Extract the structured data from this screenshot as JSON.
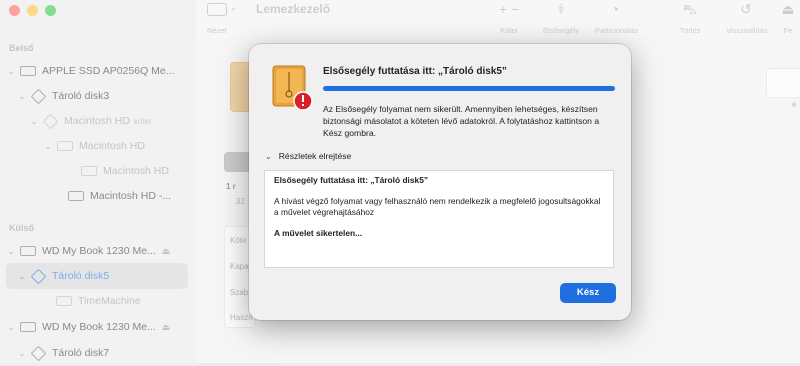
{
  "sidebar": {
    "sections": {
      "internal": "Belső",
      "external": "Külső"
    },
    "items": [
      {
        "label": "APPLE SSD AP0256Q Me..."
      },
      {
        "label": "Tároló disk3"
      },
      {
        "label": "Macintosh HD",
        "sub": "kötet"
      },
      {
        "label": "Macintosh HD"
      },
      {
        "label": "Macintosh HD"
      },
      {
        "label": "Macintosh HD -..."
      },
      {
        "label": "WD My Book 1230 Me..."
      },
      {
        "label": "Tároló disk5"
      },
      {
        "label": "TimeMachine"
      },
      {
        "label": "WD My Book 1230 Me..."
      },
      {
        "label": "Tároló disk7"
      }
    ]
  },
  "toolbar": {
    "title": "Lemezkezelő",
    "view_label": "Nézet",
    "buttons": [
      {
        "label": "Kötet",
        "glyph": "+  −"
      },
      {
        "label": "Elsősegély",
        "glyph": "⚕"
      },
      {
        "label": "Particionálás",
        "glyph": "◔"
      },
      {
        "label": "Törlés",
        "glyph": "⛍"
      },
      {
        "label": "Visszaállítás",
        "glyph": "↺"
      },
      {
        "label": "Fe",
        "glyph": "⏏"
      }
    ]
  },
  "background": {
    "rows": [
      "Köte",
      "Kapa",
      "Szab",
      "Haszn"
    ],
    "count_prefix": "1 r",
    "size_prefix": "32",
    "right_hint": "e"
  },
  "dialog": {
    "title": "Elsősegély futtatása itt: „Tároló disk5”",
    "progress_fraction": 1.0,
    "message": "Az Elsősegély folyamat nem sikerült. Amennyiben lehetséges, készítsen biztonsági másolatot a köteten lévő adatokról. A folytatáshoz kattintson a Kész gombra.",
    "details_toggle": "Részletek elrejtése",
    "log": {
      "line1": "Elsősegély futtatása itt: „Tároló disk5”",
      "line2": "A hívást végző folyamat vagy felhasználó nem rendelkezik a megfelelő jogosultságokkal a művelet végrehajtásához",
      "line3": "A művelet sikertelen..."
    },
    "done_button": "Kész"
  },
  "colors": {
    "accent": "#1f6fe0",
    "error_badge": "#d9202a",
    "disk_icon": "#e9a23b"
  }
}
